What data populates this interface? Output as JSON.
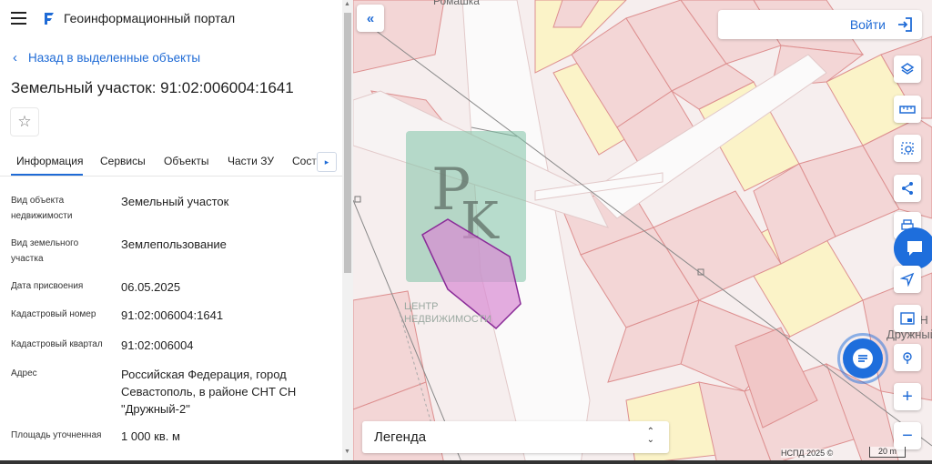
{
  "app": {
    "title": "Геоинформационный портал"
  },
  "panel": {
    "back_label": "Назад в выделенные объекты",
    "object_title": "Земельный участок: 91:02:006004:1641",
    "tabs": [
      {
        "label": "Информация",
        "active": true
      },
      {
        "label": "Сервисы",
        "active": false
      },
      {
        "label": "Объекты",
        "active": false
      },
      {
        "label": "Части ЗУ",
        "active": false
      },
      {
        "label": "Соста",
        "active": false
      }
    ],
    "fields": [
      {
        "label": "Вид объекта недвижимости",
        "value": "Земельный участок"
      },
      {
        "label": "Вид земельного участка",
        "value": "Землепользование"
      },
      {
        "label": "Дата присвоения",
        "value": "06.05.2025"
      },
      {
        "label": "Кадастровый номер",
        "value": "91:02:006004:1641"
      },
      {
        "label": "Кадастровый квартал",
        "value": "91:02:006004"
      },
      {
        "label": "Адрес",
        "value": "Российская Федерация, город Севастополь, в районе СНТ СН \"Дружный-2\""
      },
      {
        "label": "Площадь уточненная",
        "value": "1 000 кв. м"
      }
    ]
  },
  "map": {
    "login_label": "Войти",
    "legend_label": "Легенда",
    "place_label_top": "Ромашка",
    "place_label_right_1": "С СН",
    "place_label_right_2": "Дружный",
    "watermark_line1": "ЦЕНТР",
    "watermark_line2": "НЕДВИЖИМОСТИ",
    "copyright": "НСПД 2025 ©",
    "scale_label": "20 m",
    "colors": {
      "accent": "#1f6bd6",
      "parcel_fill": "#f3d6d6",
      "parcel_stroke": "#dd8f8f",
      "yellow_zone": "#fbf3c8",
      "selected_fill": "#d98ad3",
      "selected_stroke": "#8a2c98",
      "watermark": "#7fc3a5"
    },
    "tool_icons": [
      "layers-icon",
      "ruler-icon",
      "select-area-icon",
      "share-icon",
      "print-icon",
      "navigate-icon",
      "minimap-icon",
      "location-icon",
      "zoom-in-icon",
      "zoom-out-icon"
    ]
  }
}
